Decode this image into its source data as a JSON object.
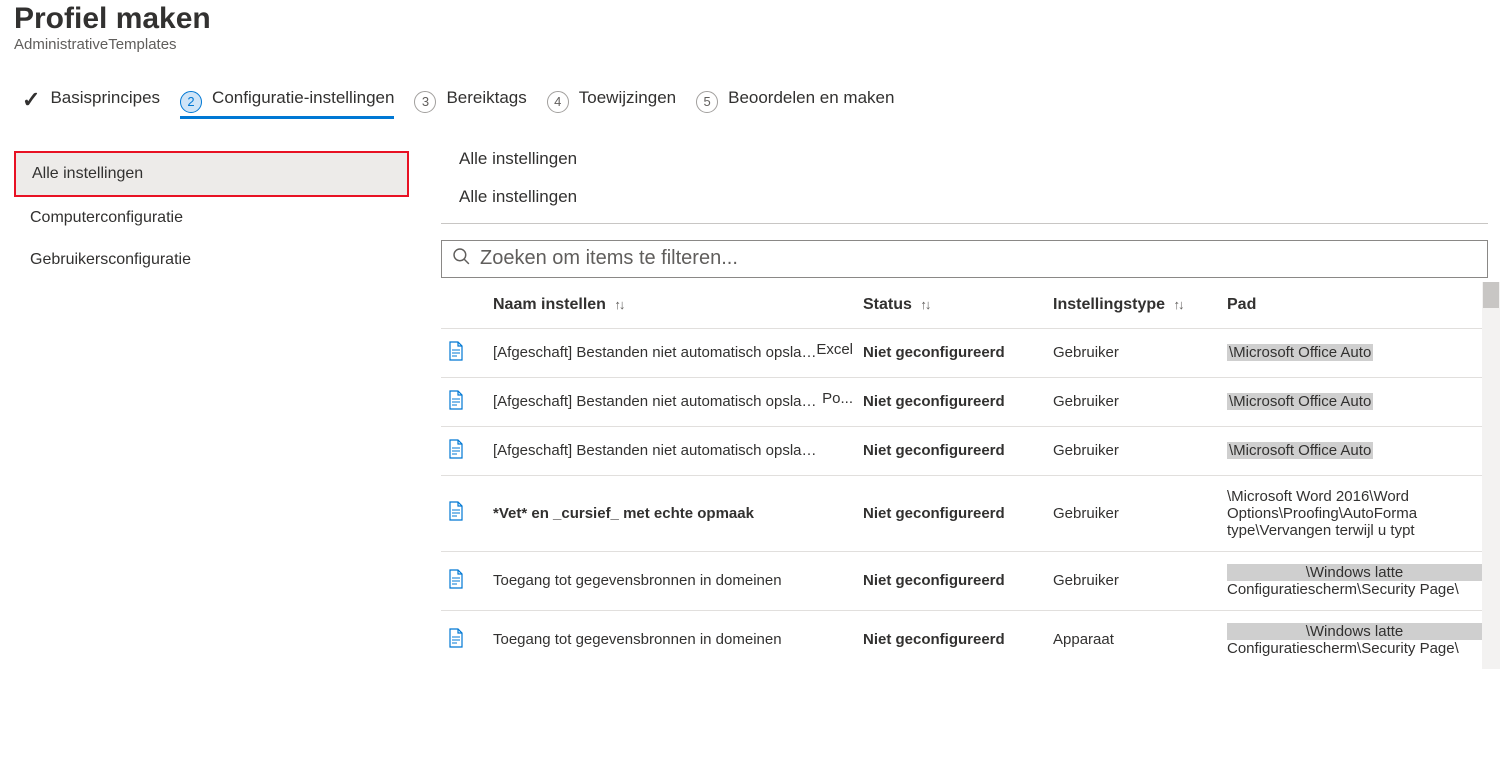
{
  "header": {
    "title": "Profiel maken",
    "subtitle": "AdministrativeTemplates"
  },
  "steps": [
    {
      "label": "Basisprincipes",
      "state": "done"
    },
    {
      "label": "Configuratie-instellingen",
      "state": "active",
      "num": "2"
    },
    {
      "label": "Bereiktags",
      "state": "todo",
      "num": "3"
    },
    {
      "label": "Toewijzingen",
      "state": "todo",
      "num": "4"
    },
    {
      "label": "Beoordelen en maken",
      "state": "todo",
      "num": "5"
    }
  ],
  "sidebar": {
    "items": [
      {
        "label": "Alle instellingen",
        "selected": true
      },
      {
        "label": "Computerconfiguratie",
        "selected": false
      },
      {
        "label": "Gebruikersconfiguratie",
        "selected": false
      }
    ]
  },
  "breadcrumb": {
    "line1": "Alle instellingen",
    "line2": "Alle instellingen"
  },
  "search": {
    "placeholder": "Zoeken om items te filteren..."
  },
  "table": {
    "headers": {
      "name": "Naam instellen",
      "status": "Status",
      "type": "Instellingstype",
      "path": "Pad"
    },
    "rows": [
      {
        "name": "[Afgeschaft] Bestanden niet automatisch opslaan in",
        "suffix": "Excel",
        "status": "Niet geconfigureerd",
        "type": "Gebruiker",
        "path_lines": [
          {
            "text": "\\Microsoft Office Auto",
            "hl": true
          }
        ]
      },
      {
        "name": "[Afgeschaft] Bestanden niet automatisch opslaan in",
        "suffix": "Po...",
        "status": "Niet geconfigureerd",
        "type": "Gebruiker",
        "path_lines": [
          {
            "text": "\\Microsoft Office Auto",
            "hl": true
          }
        ]
      },
      {
        "name": "[Afgeschaft] Bestanden niet automatisch opslaan in wo...",
        "suffix": "",
        "status": "Niet geconfigureerd",
        "type": "Gebruiker",
        "path_lines": [
          {
            "text": "\\Microsoft Office Auto",
            "hl": true
          }
        ]
      },
      {
        "name": "*Vet* en _cursief_ met echte opmaak",
        "bold": true,
        "suffix": "",
        "status": "Niet geconfigureerd",
        "type": "Gebruiker",
        "path_lines": [
          {
            "text": "\\Microsoft Word 2016\\Word"
          },
          {
            "text": "Options\\Proofing\\AutoForma"
          },
          {
            "text": "type\\Vervangen terwijl u typt"
          }
        ]
      },
      {
        "name": "Toegang tot gegevensbronnen in domeinen",
        "suffix": "",
        "status": "Niet geconfigureerd",
        "type": "Gebruiker",
        "path_lines": [
          {
            "text": "\\Windows latte",
            "hl": true,
            "center": true
          },
          {
            "text": "Configuratiescherm\\Security Page\\"
          }
        ]
      },
      {
        "name": "Toegang tot gegevensbronnen in domeinen",
        "suffix": "",
        "status": "Niet geconfigureerd",
        "type": "Apparaat",
        "path_lines": [
          {
            "text": "\\Windows latte",
            "hl": true,
            "center": true
          },
          {
            "text": "Configuratiescherm\\Security Page\\"
          }
        ]
      }
    ]
  }
}
